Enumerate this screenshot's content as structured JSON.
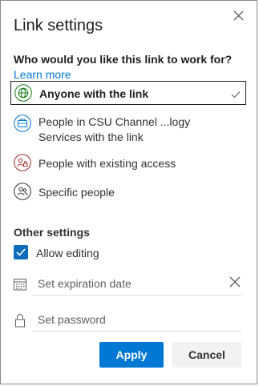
{
  "dialog": {
    "title": "Link settings",
    "question": "Who would you like this link to work for?",
    "learn_more": "Learn more"
  },
  "options": [
    {
      "label": "Anyone with the link",
      "icon": "globe-icon",
      "color": "#107c10",
      "selected": true
    },
    {
      "label_line1": "People in CSU Channel ...logy",
      "label_line2": "Services with the link",
      "icon": "briefcase-icon",
      "color": "#0078d4",
      "selected": false
    },
    {
      "label": "People with existing access",
      "icon": "people-lock-icon",
      "color": "#a4262c",
      "selected": false
    },
    {
      "label": "Specific people",
      "icon": "people-icon",
      "color": "#323130",
      "selected": false
    }
  ],
  "other_settings": {
    "heading": "Other settings",
    "allow_editing_label": "Allow editing",
    "allow_editing_checked": true,
    "expiration_placeholder": "Set expiration date",
    "password_placeholder": "Set password"
  },
  "buttons": {
    "apply": "Apply",
    "cancel": "Cancel"
  },
  "colors": {
    "accent": "#0078d4",
    "border": "#8a8886"
  }
}
